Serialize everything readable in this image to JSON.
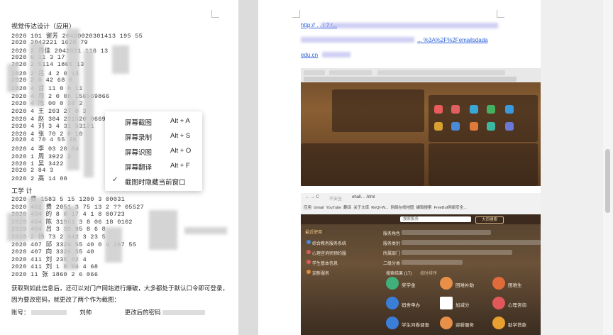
{
  "left_doc": {
    "title": "视觉传达设计（应用）",
    "rows": [
      "2020    101  谢芳 20420020301413  195    55",
      "2020              2042221  1620   79",
      "2020   2 周佳     2042021   116   13",
      "2020               6   11   3 17",
      "2020   2           5114   1865    13",
      "2020   2     吕    4    2 0    13",
      "2020   2         0 42 68     0",
      "2020   4     首   11 0    0 11",
      "2020   4   周   2  0 08  156569866",
      "2020   4   陈   00 0 30 2 ",
      "2020   4   王   203  27 0 3 ",
      "2020   4   赵   304   231520  0669",
      "2020   4   刘   3 4  31    53121",
      "2020   4   张   70 2   8   10",
      "2020   4       70 4   55   38",
      "2020   4   李   03  20   84"
    ],
    "rows2": [
      "2020      1  周  3922  2 ",
      "2020      1  吴  3422 ",
      "2020   2       84  3 ",
      "2020   2   高   14  00"
    ],
    "section": "工学 计",
    "rows3": [
      "2020       费   1583  5  15  1200   3 00031",
      "2020   402 费   2051  3  75  13 2  ??  05527",
      "2020   404 的     8     0 17  4 1 8  00723",
      "2020   404 陈   31961  3   8  06 18  0102",
      "2020   404 吕   3 30  85   8  6  8 ",
      "2020   2   杨    73  2  042 3  23  5",
      "2020   407 邱   3326  55  40  0  4   267 55",
      "2020   407 向   3326  55  40",
      "2020   411 刘    235  02  4  ",
      "2020   411 刘    1 8  96  4  68",
      "2020   11  张     1860  2  6  066"
    ],
    "paragraph": [
      "获取到如此信息后，还可以对门户网站进行爆破，大多都处于默认口令即可登录，",
      "因为要改密码，就更改了两个作为截图："
    ],
    "account_label": "账号：",
    "account_name": "刘帅",
    "new_password_label": "更改后的密码"
  },
  "context_menu": {
    "items": [
      {
        "label": "屏幕截图",
        "shortcut": "Alt + A",
        "checked": false
      },
      {
        "label": "屏幕录制",
        "shortcut": "Alt + S",
        "checked": false
      },
      {
        "label": "屏幕识图",
        "shortcut": "Alt + O",
        "checked": false
      },
      {
        "label": "屏幕翻译",
        "shortcut": "Alt + F",
        "checked": false
      },
      {
        "label": "截图时隐藏当前窗口",
        "shortcut": "",
        "checked": true
      }
    ],
    "check_glyph": "✓"
  },
  "right_doc": {
    "link1": "http://  .  .  /  ?   /...  ",
    "link2": "  ...  %3A%2F%2Femailsdada",
    "link3": "edu.cn",
    "shot2_address_prefix": "不安全",
    "shot2_address": "ehall.      .       .html",
    "shot2_bookmarks": [
      "应用",
      "Gmail",
      "YouTube",
      "翻译",
      "关于文库",
      "ReQt-W...",
      "网络在线地图",
      "编辑搜索",
      "FreeBuf网络安全..."
    ],
    "shot2_search": "搜索服务",
    "shot2_button": "大同搜索",
    "shot2_sidebar_title": "最近使用",
    "shot2_sidebar": [
      "综合教务服务系统",
      "心理咨询师预约服",
      "学生基本信息",
      "迎新服务"
    ],
    "shot2_filter_labels": [
      "服务角色",
      "服务类别",
      "所属部门",
      "二级分类"
    ],
    "shot2_results_label": "搜索结果 (17)",
    "shot2_results_sort": "按时排序",
    "shot2_apps": [
      "奖学金",
      "困难补助",
      "困难生",
      "宿舍申办",
      "加减分",
      "心理咨询",
      "学生问卷调查",
      "迎新服务",
      "助学贷款"
    ]
  },
  "colors": {
    "link": "#2b5fd9",
    "menu_bg": "#ffffff",
    "page_bg": "#ffffff",
    "workspace": "#e9e9e9"
  }
}
